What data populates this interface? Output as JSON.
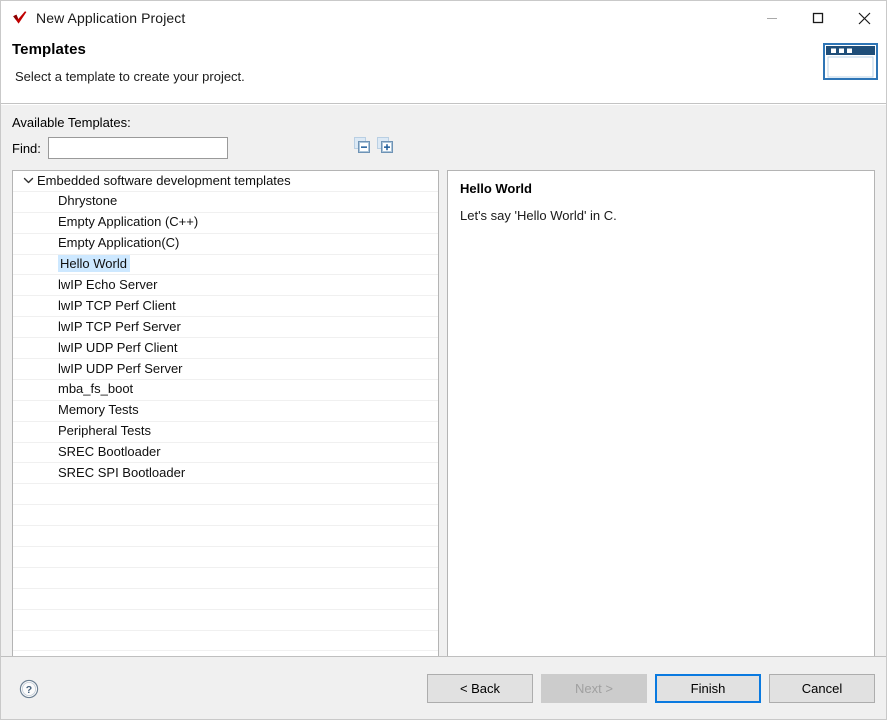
{
  "window": {
    "title": "New Application Project",
    "app_icon": "red-check-icon",
    "minimize_label": "Minimize",
    "maximize_label": "Maximize",
    "close_label": "Close"
  },
  "header": {
    "title": "Templates",
    "subtitle": "Select a template to create your project.",
    "graphic": "window-banner-icon",
    "graphic_color": "#1F4E79"
  },
  "body": {
    "available_label": "Available Templates:",
    "find_label": "Find:",
    "find_value": "",
    "find_placeholder": "",
    "collapse_all_label": "Collapse All",
    "expand_all_label": "Expand All"
  },
  "tree": {
    "group": {
      "label": "Embedded software development templates",
      "expanded": true
    },
    "items": [
      {
        "label": "Dhrystone",
        "selected": false
      },
      {
        "label": "Empty Application (C++)",
        "selected": false
      },
      {
        "label": "Empty Application(C)",
        "selected": false
      },
      {
        "label": "Hello World",
        "selected": true
      },
      {
        "label": "lwIP Echo Server",
        "selected": false
      },
      {
        "label": "lwIP TCP Perf Client",
        "selected": false
      },
      {
        "label": "lwIP TCP Perf Server",
        "selected": false
      },
      {
        "label": "lwIP UDP Perf Client",
        "selected": false
      },
      {
        "label": "lwIP UDP Perf Server",
        "selected": false
      },
      {
        "label": "mba_fs_boot",
        "selected": false
      },
      {
        "label": "Memory Tests",
        "selected": false
      },
      {
        "label": "Peripheral Tests",
        "selected": false
      },
      {
        "label": "SREC Bootloader",
        "selected": false
      },
      {
        "label": "SREC SPI Bootloader",
        "selected": false
      }
    ],
    "empty_row_count": 8,
    "selection_color": "#CDE8FF"
  },
  "description": {
    "title": "Hello World",
    "text": "Let's say 'Hello World' in C."
  },
  "footer": {
    "help_label": "Help",
    "buttons": [
      {
        "label": "< Back",
        "state": "enabled",
        "name": "back-button"
      },
      {
        "label": "Next >",
        "state": "disabled",
        "name": "next-button"
      },
      {
        "label": "Finish",
        "state": "default",
        "name": "finish-button"
      },
      {
        "label": "Cancel",
        "state": "enabled",
        "name": "cancel-button"
      }
    ],
    "default_button_border_color": "#0A7AE0"
  }
}
